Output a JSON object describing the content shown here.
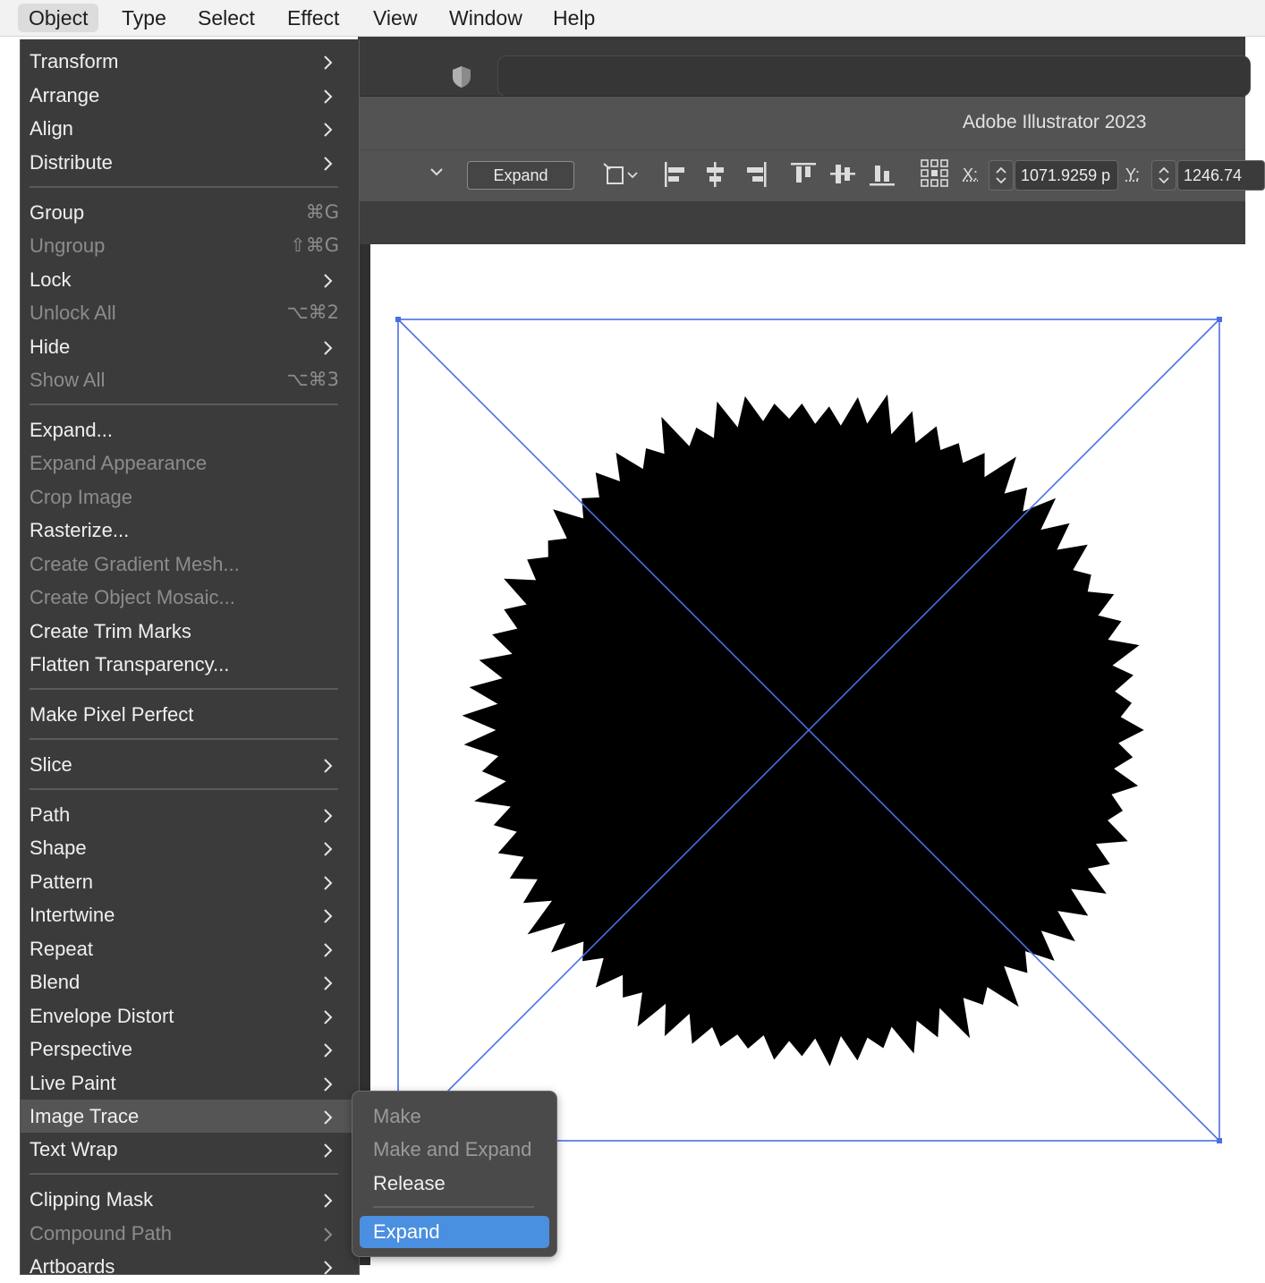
{
  "menubar": {
    "items": [
      "Object",
      "Type",
      "Select",
      "Effect",
      "View",
      "Window",
      "Help"
    ],
    "active": "Object"
  },
  "app": {
    "title": "Adobe Illustrator 2023"
  },
  "control_bar": {
    "expand_button": "Expand",
    "x_label": "X:",
    "x_value": "1071.9259 p",
    "y_label": "Y:",
    "y_value": "1246.74"
  },
  "object_menu": {
    "items": [
      {
        "label": "Transform",
        "submenu": true
      },
      {
        "label": "Arrange",
        "submenu": true
      },
      {
        "label": "Align",
        "submenu": true
      },
      {
        "label": "Distribute",
        "submenu": true
      },
      {
        "label": "Group",
        "shortcut": "⌘G"
      },
      {
        "label": "Ungroup",
        "shortcut": "⇧⌘G",
        "disabled": true
      },
      {
        "label": "Lock",
        "submenu": true
      },
      {
        "label": "Unlock All",
        "shortcut": "⌥⌘2",
        "disabled": true
      },
      {
        "label": "Hide",
        "submenu": true
      },
      {
        "label": "Show All",
        "shortcut": "⌥⌘3",
        "disabled": true
      },
      {
        "label": "Expand..."
      },
      {
        "label": "Expand Appearance",
        "disabled": true
      },
      {
        "label": "Crop Image",
        "disabled": true
      },
      {
        "label": "Rasterize..."
      },
      {
        "label": "Create Gradient Mesh...",
        "disabled": true
      },
      {
        "label": "Create Object Mosaic...",
        "disabled": true
      },
      {
        "label": "Create Trim Marks"
      },
      {
        "label": "Flatten Transparency..."
      },
      {
        "label": "Make Pixel Perfect"
      },
      {
        "label": "Slice",
        "submenu": true
      },
      {
        "label": "Path",
        "submenu": true
      },
      {
        "label": "Shape",
        "submenu": true
      },
      {
        "label": "Pattern",
        "submenu": true
      },
      {
        "label": "Intertwine",
        "submenu": true
      },
      {
        "label": "Repeat",
        "submenu": true
      },
      {
        "label": "Blend",
        "submenu": true
      },
      {
        "label": "Envelope Distort",
        "submenu": true
      },
      {
        "label": "Perspective",
        "submenu": true
      },
      {
        "label": "Live Paint",
        "submenu": true
      },
      {
        "label": "Image Trace",
        "submenu": true,
        "highlighted": true
      },
      {
        "label": "Text Wrap",
        "submenu": true
      },
      {
        "label": "Clipping Mask",
        "submenu": true
      },
      {
        "label": "Compound Path",
        "submenu": true,
        "disabled": true
      },
      {
        "label": "Artboards",
        "submenu": true
      }
    ]
  },
  "image_trace_submenu": {
    "items": [
      {
        "label": "Make",
        "disabled": true
      },
      {
        "label": "Make and Expand",
        "disabled": true
      },
      {
        "label": "Release"
      },
      {
        "label": "Expand",
        "selected": true
      }
    ]
  },
  "colors": {
    "menu_bg": "#3b3b3b",
    "selection_blue": "#4a8fe0",
    "bounding_box": "#4a6fe0"
  }
}
